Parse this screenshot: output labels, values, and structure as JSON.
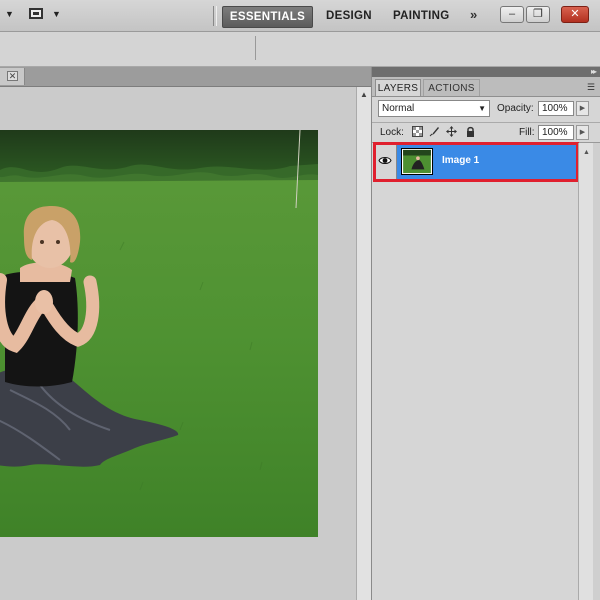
{
  "workspace": {
    "items": [
      "ESSENTIALS",
      "DESIGN",
      "PAINTING"
    ],
    "active": "ESSENTIALS",
    "more_glyph": "»"
  },
  "window_controls": {
    "minimize": "–",
    "restore": "❐",
    "close": "✕"
  },
  "layers_panel": {
    "tabs": [
      "LAYERS",
      "ACTIONS"
    ],
    "blend_mode": "Normal",
    "opacity_label": "Opacity:",
    "opacity_value": "100%",
    "lock_label": "Lock:",
    "fill_label": "Fill:",
    "fill_value": "100%",
    "layers": [
      {
        "name": "Image 1",
        "visible": true,
        "selected": true
      }
    ]
  },
  "colors": {
    "selection_blue": "#3a8ae6",
    "highlight_red": "#e0202e",
    "active_workspace": "#6a6a6a"
  }
}
